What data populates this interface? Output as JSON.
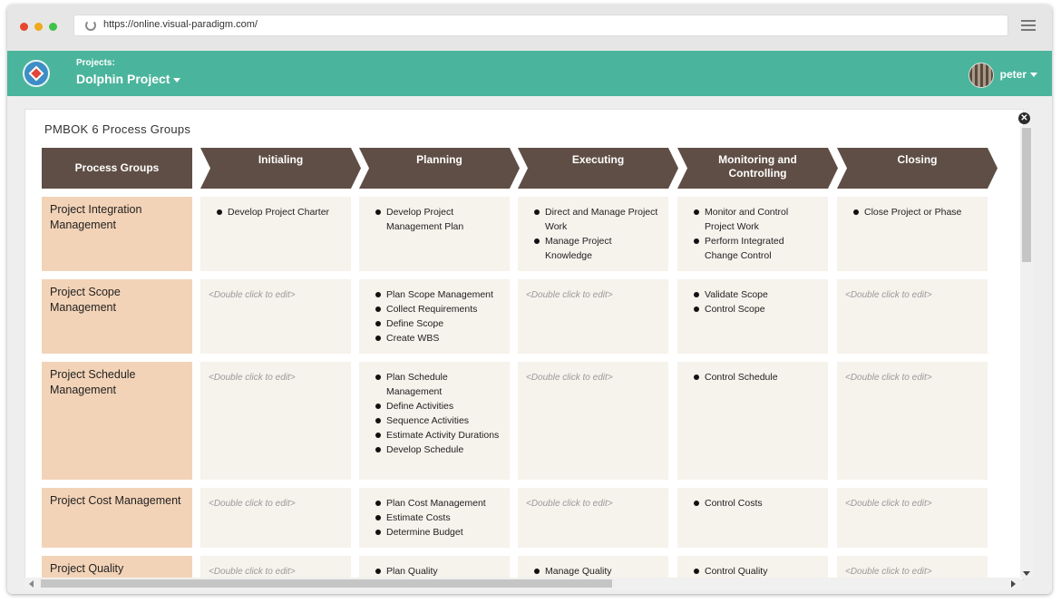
{
  "browser": {
    "url": "https://online.visual-paradigm.com/"
  },
  "appbar": {
    "projects_label": "Projects:",
    "project_name": "Dolphin Project",
    "username": "peter"
  },
  "colors": {
    "appbar": "#4ab59c",
    "header": "#5f4e45",
    "row_header": "#f3d3b7",
    "cell": "#f6f2ec"
  },
  "sheet": {
    "title": "PMBOK 6 Process Groups",
    "corner_header": "Process Groups",
    "phases": [
      "Initialing",
      "Planning",
      "Executing",
      "Monitoring and Controlling",
      "Closing"
    ],
    "placeholder": "<Double click to edit>",
    "rows": [
      {
        "label": "Project Integration Management",
        "cells": [
          [
            "Develop Project Charter"
          ],
          [
            "Develop Project Management Plan"
          ],
          [
            "Direct and Manage Project Work",
            "Manage Project Knowledge"
          ],
          [
            "Monitor and Control Project Work",
            "Perform Integrated Change Control"
          ],
          [
            "Close Project or Phase"
          ]
        ]
      },
      {
        "label": "Project Scope Management",
        "cells": [
          [],
          [
            "Plan Scope Management",
            "Collect Requirements",
            "Define Scope",
            "Create WBS"
          ],
          [],
          [
            "Validate Scope",
            "Control Scope"
          ],
          []
        ]
      },
      {
        "label": "Project Schedule Management",
        "cells": [
          [],
          [
            "Plan Schedule Management",
            "Define Activities",
            "Sequence Activities",
            "Estimate Activity Durations",
            "Develop Schedule"
          ],
          [],
          [
            "Control Schedule"
          ],
          []
        ]
      },
      {
        "label": "Project Cost Management",
        "cells": [
          [],
          [
            "Plan Cost Management",
            "Estimate Costs",
            "Determine Budget"
          ],
          [],
          [
            "Control Costs"
          ],
          []
        ]
      },
      {
        "label": "Project Quality",
        "cells": [
          [],
          [
            "Plan Quality"
          ],
          [
            "Manage Quality"
          ],
          [
            "Control Quality"
          ],
          []
        ]
      }
    ]
  }
}
